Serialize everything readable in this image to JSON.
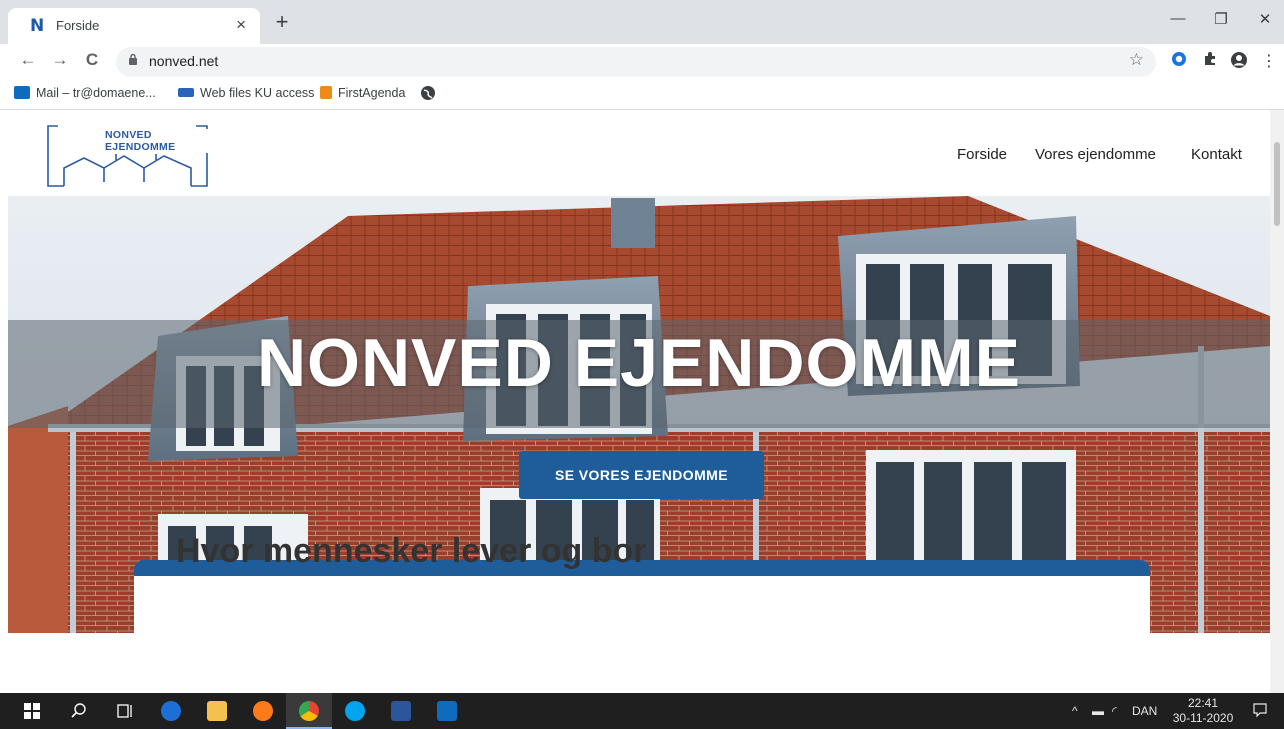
{
  "browser": {
    "tab": {
      "title": "Forside",
      "favicon": "N",
      "close": "×"
    },
    "new_tab": "+",
    "window": {
      "minimize": "—",
      "restore": "❐",
      "close": "✕"
    },
    "nav": {
      "back": "←",
      "forward": "→",
      "reload": "C"
    },
    "url": "nonved.net",
    "bookmarks": [
      {
        "label": "Mail – tr@domaene...",
        "color": "#0f6cbd"
      },
      {
        "label": "Web files KU access",
        "color": "#2a63b8"
      },
      {
        "label": "FirstAgenda",
        "color": "#f08a16"
      }
    ]
  },
  "site": {
    "logo_text": "NONVED EJENDOMME",
    "nav": [
      "Forside",
      "Vores ejendomme",
      "Kontakt"
    ],
    "hero": {
      "title": "NONVED EJENDOMME",
      "button": "SE VORES EJENDOMME"
    },
    "section_heading": "Hvor mennesker lever og bor",
    "accent_color": "#1f5d9a"
  },
  "taskbar": {
    "language": "DAN",
    "time": "22:41",
    "date": "30-11-2020"
  }
}
